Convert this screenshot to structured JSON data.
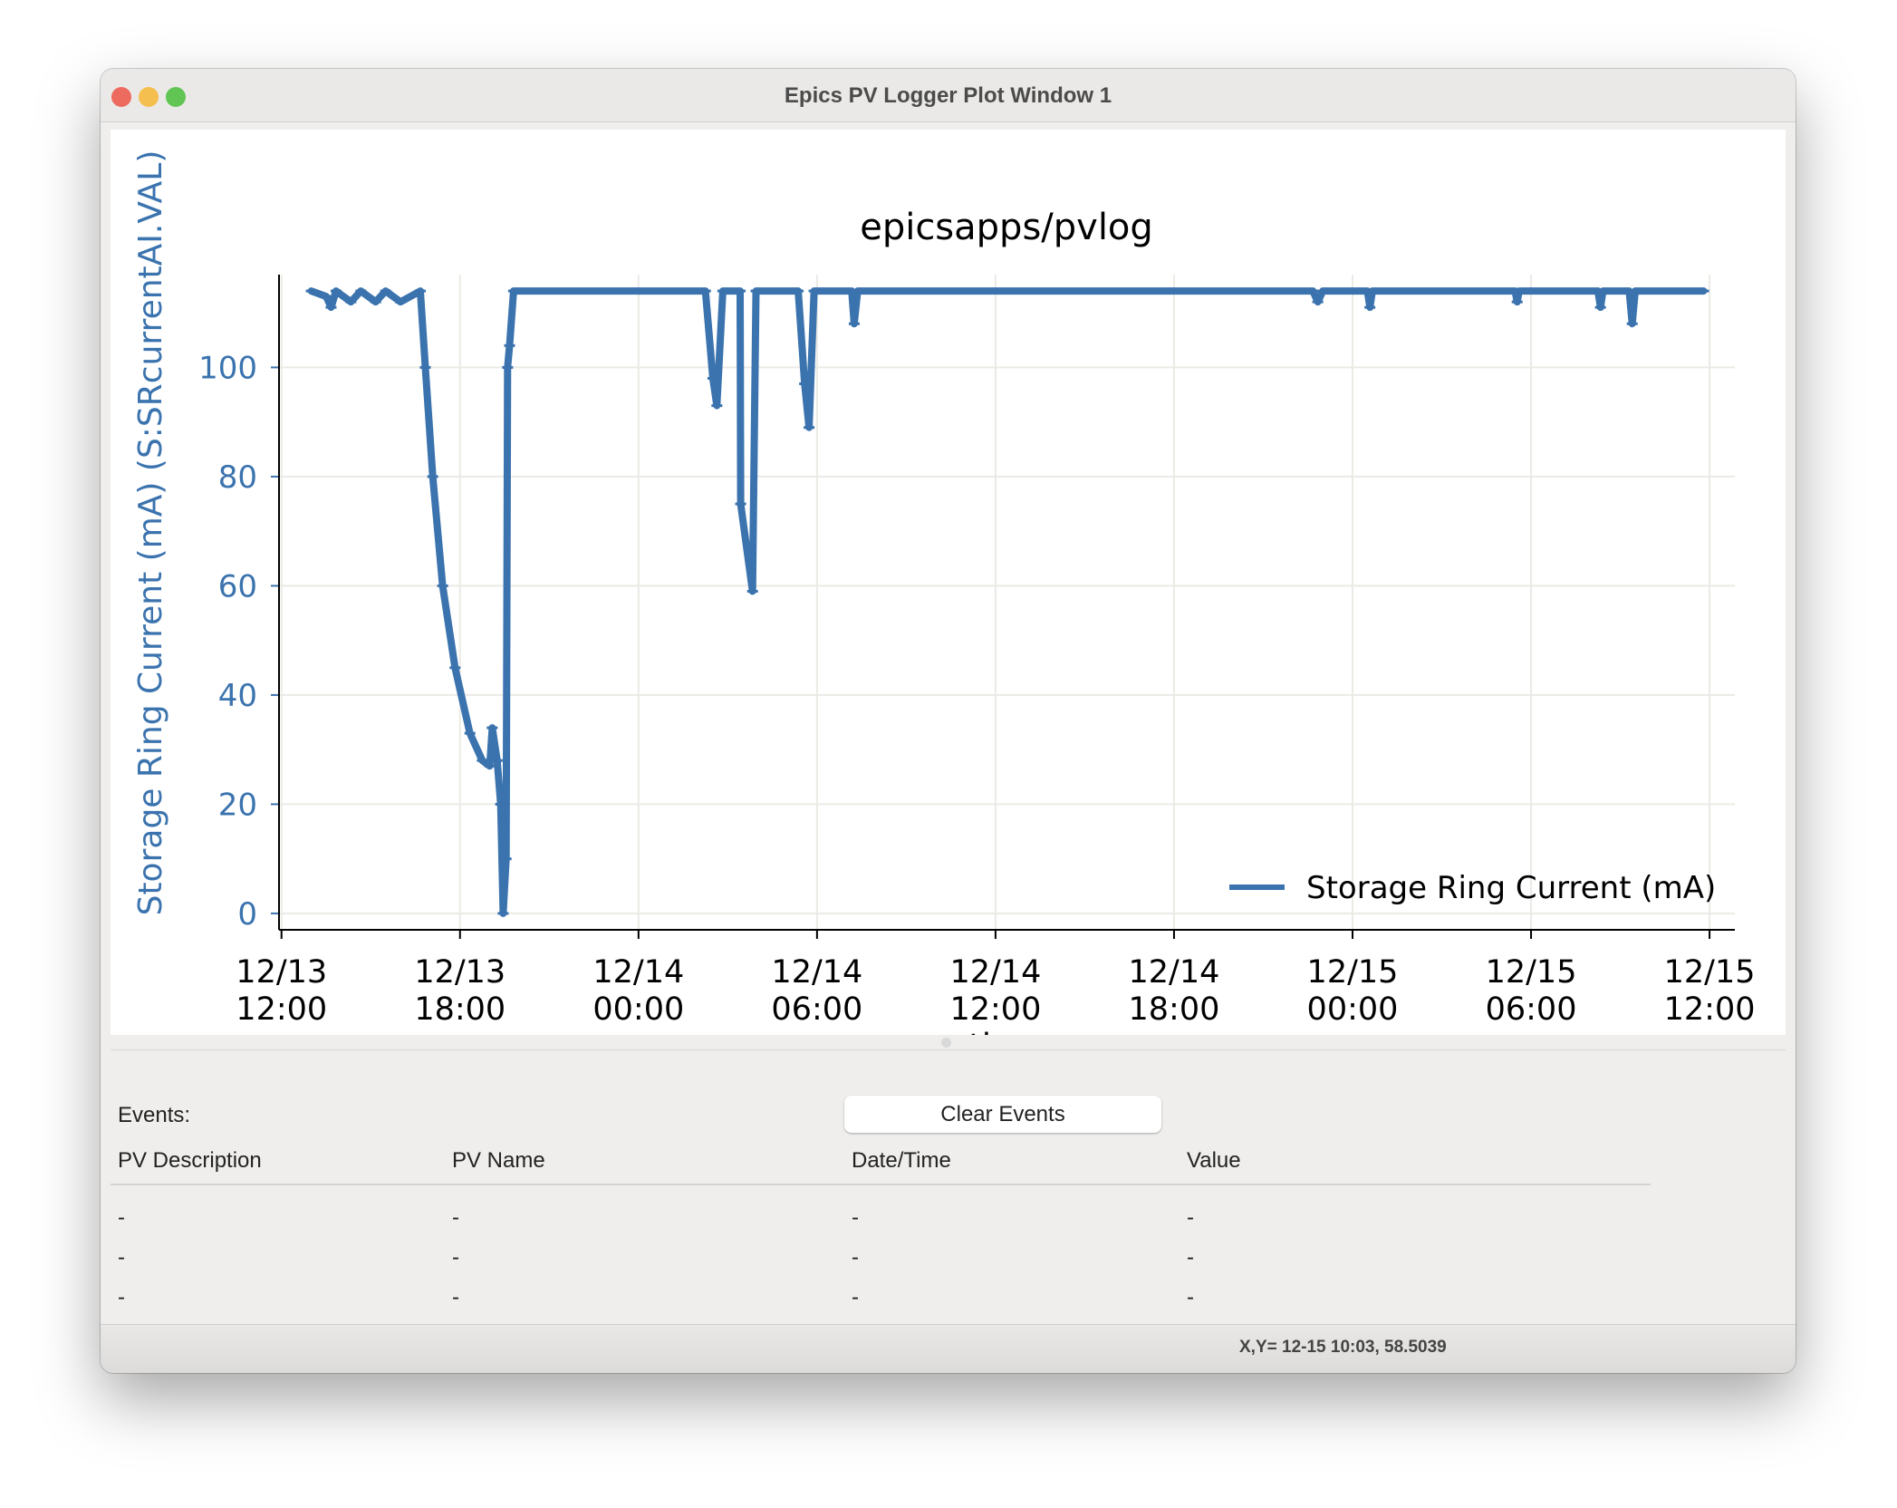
{
  "window": {
    "title": "Epics PV Logger Plot Window 1",
    "traffic_lights": {
      "close": "#ed6a5e",
      "minimize": "#f5bf4f",
      "zoom": "#61c554"
    }
  },
  "chart_data": {
    "type": "line",
    "title": "epicsapps/pvlog",
    "xlabel": "time",
    "ylabel": "Storage Ring Current (mA) (S:SRcurrentAI.VAL)",
    "ylabel_color": "#3b73ae",
    "color": "#3b73ae",
    "grid": true,
    "legend_position": "lower-right",
    "ylim": [
      -3,
      117
    ],
    "yticks": [
      0,
      20,
      40,
      60,
      80,
      100
    ],
    "xlim": [
      "12/13 11:55",
      "12/15 12:51"
    ],
    "xticks": [
      {
        "t": "12/13 12:00",
        "line1": "12/13",
        "line2": "12:00"
      },
      {
        "t": "12/13 18:00",
        "line1": "12/13",
        "line2": "18:00"
      },
      {
        "t": "12/14 00:00",
        "line1": "12/14",
        "line2": "00:00"
      },
      {
        "t": "12/14 06:00",
        "line1": "12/14",
        "line2": "06:00"
      },
      {
        "t": "12/14 12:00",
        "line1": "12/14",
        "line2": "12:00"
      },
      {
        "t": "12/14 18:00",
        "line1": "12/14",
        "line2": "18:00"
      },
      {
        "t": "12/15 00:00",
        "line1": "12/15",
        "line2": "00:00"
      },
      {
        "t": "12/15 06:00",
        "line1": "12/15",
        "line2": "06:00"
      },
      {
        "t": "12/15 12:00",
        "line1": "12/15",
        "line2": "12:00"
      }
    ],
    "series": [
      {
        "name": "Storage Ring Current (mA)",
        "points": [
          [
            "12/13 13:00",
            114
          ],
          [
            "12/13 13:30",
            113
          ],
          [
            "12/13 13:40",
            111
          ],
          [
            "12/13 13:50",
            114
          ],
          [
            "12/13 14:20",
            112
          ],
          [
            "12/13 14:40",
            114
          ],
          [
            "12/13 15:10",
            112
          ],
          [
            "12/13 15:30",
            114
          ],
          [
            "12/13 16:00",
            112
          ],
          [
            "12/13 16:40",
            114
          ],
          [
            "12/13 16:50",
            100
          ],
          [
            "12/13 17:05",
            80
          ],
          [
            "12/13 17:25",
            60
          ],
          [
            "12/13 17:50",
            45
          ],
          [
            "12/13 18:20",
            33
          ],
          [
            "12/13 18:45",
            28
          ],
          [
            "12/13 19:00",
            27
          ],
          [
            "12/13 19:05",
            34
          ],
          [
            "12/13 19:15",
            28
          ],
          [
            "12/13 19:22",
            20
          ],
          [
            "12/13 19:27",
            0
          ],
          [
            "12/13 19:33",
            10
          ],
          [
            "12/13 19:36",
            100
          ],
          [
            "12/13 19:40",
            104
          ],
          [
            "12/13 19:48",
            114
          ],
          [
            "12/14 02:15",
            114
          ],
          [
            "12/14 02:30",
            98
          ],
          [
            "12/14 02:38",
            93
          ],
          [
            "12/14 02:50",
            114
          ],
          [
            "12/14 03:25",
            114
          ],
          [
            "12/14 03:26",
            75
          ],
          [
            "12/14 03:50",
            59
          ],
          [
            "12/14 03:57",
            114
          ],
          [
            "12/14 05:22",
            114
          ],
          [
            "12/14 05:35",
            97
          ],
          [
            "12/14 05:44",
            89
          ],
          [
            "12/14 05:54",
            114
          ],
          [
            "12/14 07:10",
            114
          ],
          [
            "12/14 07:15",
            108
          ],
          [
            "12/14 07:22",
            114
          ],
          [
            "12/14 22:40",
            114
          ],
          [
            "12/14 22:50",
            112
          ],
          [
            "12/14 23:00",
            114
          ],
          [
            "12/15 00:30",
            114
          ],
          [
            "12/15 00:35",
            111
          ],
          [
            "12/15 00:40",
            114
          ],
          [
            "12/15 05:28",
            114
          ],
          [
            "12/15 05:32",
            112
          ],
          [
            "12/15 05:36",
            114
          ],
          [
            "12/15 08:15",
            114
          ],
          [
            "12/15 08:20",
            111
          ],
          [
            "12/15 08:25",
            114
          ],
          [
            "12/15 09:18",
            114
          ],
          [
            "12/15 09:24",
            108
          ],
          [
            "12/15 09:30",
            114
          ],
          [
            "12/15 11:48",
            114
          ]
        ]
      }
    ]
  },
  "events": {
    "label": "Events:",
    "clear_button": "Clear Events",
    "columns": [
      "PV Description",
      "PV Name",
      "Date/Time",
      "Value"
    ],
    "rows": [
      [
        "-",
        "-",
        "-",
        "-"
      ],
      [
        "-",
        "-",
        "-",
        "-"
      ],
      [
        "-",
        "-",
        "-",
        "-"
      ]
    ]
  },
  "status": {
    "cursor_readout": "X,Y= 12-15 10:03, 58.5039"
  }
}
